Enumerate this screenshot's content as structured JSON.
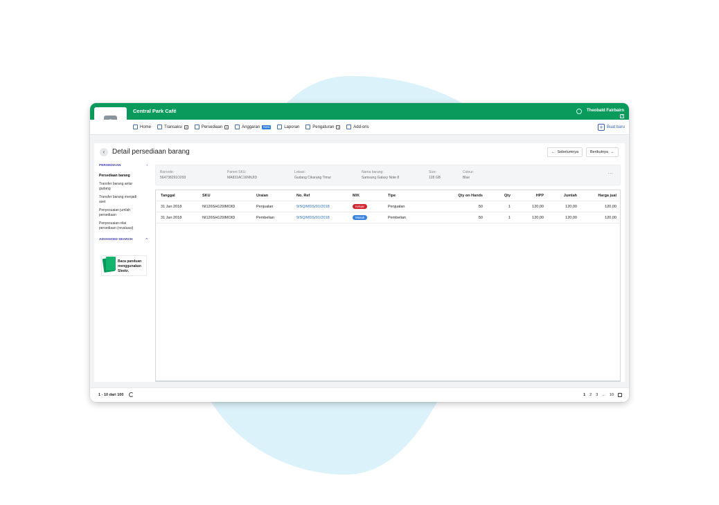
{
  "app": {
    "company": "Central Park Café",
    "user_name": "Theobald Fairbairn",
    "logo_letter": "S",
    "brand_color": "#0a9a5c"
  },
  "nav": {
    "items": [
      {
        "label": "Home",
        "icon": "home-icon"
      },
      {
        "label": "Transaksi",
        "icon": "transaction-icon",
        "has_help": true
      },
      {
        "label": "Persediaan",
        "icon": "inventory-icon",
        "has_help": true
      },
      {
        "label": "Anggaran",
        "icon": "budget-icon",
        "badge": "New"
      },
      {
        "label": "Laporan",
        "icon": "report-icon"
      },
      {
        "label": "Pengaturan",
        "icon": "gear-icon",
        "has_help": true
      },
      {
        "label": "Add-ons",
        "icon": "addons-icon"
      }
    ],
    "help_glyph": "?",
    "create_new": "Buat baru"
  },
  "page": {
    "title": "Detail persediaan barang",
    "prev_label": "Sebelumnya",
    "next_label": "Berikutnya"
  },
  "sidebar": {
    "section_title": "PERSEDIAAN",
    "links": [
      {
        "label": "Persediaan barang",
        "active": true
      },
      {
        "label": "Transfer barang antar gudang"
      },
      {
        "label": "Transfer barang menjadi aset"
      },
      {
        "label": "Penyesuaian jumlah persediaan"
      },
      {
        "label": "Penyesuaian nilai persediaan (revaluasi)"
      }
    ],
    "advanced_search": "ADVANCED SEARCH",
    "guide_text": "Baca panduan menggunakan Sleekr."
  },
  "info": {
    "fields": [
      {
        "label": "Barcode:",
        "value": "564738291O293"
      },
      {
        "label": "Parent SKU:",
        "value": "MA831AC16NNJID"
      },
      {
        "label": "Lokasi:",
        "value": "Gudang Cikarang Timur"
      },
      {
        "label": "Nama barang:",
        "value": "Samsung Galaxy Note 8"
      },
      {
        "label": "Size:",
        "value": "128 GB"
      },
      {
        "label": "Colour:",
        "value": "Blue"
      }
    ],
    "more": "..."
  },
  "table": {
    "headers": {
      "tanggal": "Tanggal",
      "sku": "SKU",
      "uraian": "Uraian",
      "noref": "No. Ref",
      "mk": "M/K",
      "tipe": "Tipe",
      "qoh": "Qty on Hands",
      "qty": "Qty",
      "hpp": "HPP",
      "jumlah": "Jumlah",
      "harga": "Harga jual"
    },
    "rows": [
      {
        "tanggal": "31 Jan 2018",
        "sku": "NI126SH129IMOID",
        "uraian": "Penjualan",
        "noref": "9/SQ/MDS/01/2018",
        "mk": "Keluar",
        "mk_color": "#d0252f",
        "tipe": "Penjualan",
        "qoh": "50",
        "qty": "1",
        "hpp": "120,00",
        "jumlah": "120,00",
        "harga": "120,00"
      },
      {
        "tanggal": "31 Jan 2018",
        "sku": "NI126SH129IMOID",
        "uraian": "Pembelian",
        "noref": "9/SQ/MDS/01/2018",
        "mk": "Masuk",
        "mk_color": "#3a82e0",
        "tipe": "Pembelian",
        "qoh": "50",
        "qty": "1",
        "hpp": "120,00",
        "jumlah": "120,00",
        "harga": "120,00"
      }
    ]
  },
  "footer": {
    "count": "1 - 10 dari 100",
    "pages": [
      "1",
      "2",
      "3",
      "...",
      "10"
    ]
  }
}
